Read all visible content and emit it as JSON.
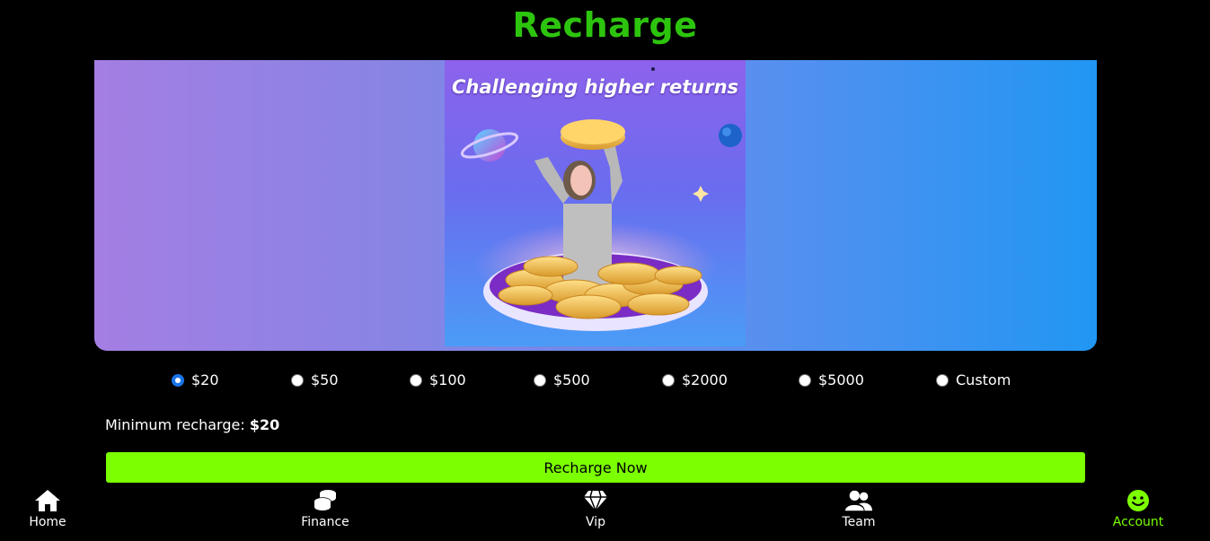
{
  "header": {
    "title": "Recharge"
  },
  "banner": {
    "heading": "Challenging higher returns"
  },
  "amounts": {
    "selected": "$20",
    "options": [
      "$20",
      "$50",
      "$100",
      "$500",
      "$2000",
      "$5000",
      "Custom"
    ]
  },
  "minimum": {
    "label": "Minimum recharge:",
    "value": "$20"
  },
  "action": {
    "button_label": "Recharge Now"
  },
  "nav": {
    "items": [
      {
        "label": "Home",
        "icon": "home-icon"
      },
      {
        "label": "Finance",
        "icon": "coins-icon"
      },
      {
        "label": "Vip",
        "icon": "diamond-icon"
      },
      {
        "label": "Team",
        "icon": "users-icon"
      },
      {
        "label": "Account",
        "icon": "smile-icon",
        "active": true
      }
    ]
  },
  "colors": {
    "title": "#2dc40e",
    "accent": "#7cff00",
    "radio": "#1a73e8"
  }
}
